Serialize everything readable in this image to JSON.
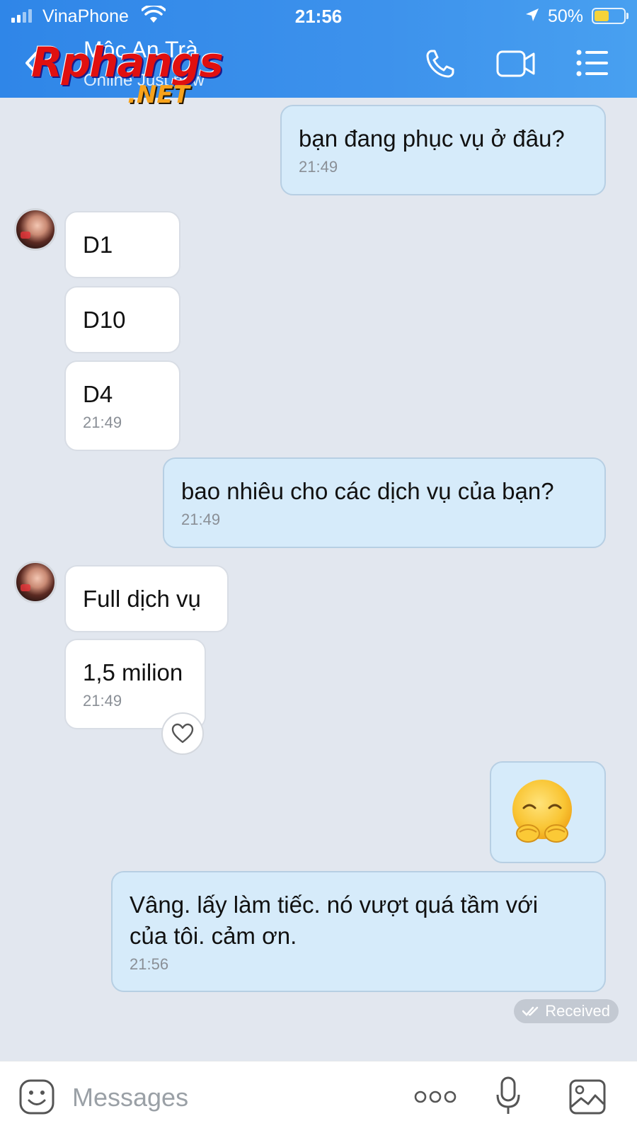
{
  "status_bar": {
    "carrier": "VinaPhone",
    "time": "21:56",
    "battery_percent": "50%",
    "battery_level": 0.5
  },
  "header": {
    "contact_name": "Mộc An Trà",
    "contact_status": "Online Just now",
    "watermark_main": "Rphangs",
    "watermark_sub": ".NET"
  },
  "messages": [
    {
      "direction": "out",
      "text": "bạn đang phục vụ ở đâu?",
      "time": "21:49"
    },
    {
      "direction": "in",
      "text": "D1"
    },
    {
      "direction": "in",
      "text": "D10"
    },
    {
      "direction": "in",
      "text": "D4",
      "time": "21:49"
    },
    {
      "direction": "out",
      "text": "bao nhiêu cho các dịch vụ của bạn?",
      "time": "21:49"
    },
    {
      "direction": "in",
      "text": "Full dịch vụ"
    },
    {
      "direction": "in",
      "text": "1,5 milion",
      "time": "21:49"
    },
    {
      "direction": "out",
      "type": "emoji",
      "emoji": "pleading-face-hands"
    },
    {
      "direction": "out",
      "text_line1": "Vâng.  lấy làm tiếc.  nó vượt quá tầm với",
      "text_line2": "của tôi.  cảm ơn.",
      "time": "21:56"
    }
  ],
  "delivery_status": "Received",
  "composer": {
    "placeholder": "Messages"
  },
  "colors": {
    "header_blue": "#2f86e8",
    "outgoing_bubble": "#d6ebfa",
    "incoming_bubble": "#ffffff",
    "chat_background": "#e2e7ef"
  }
}
